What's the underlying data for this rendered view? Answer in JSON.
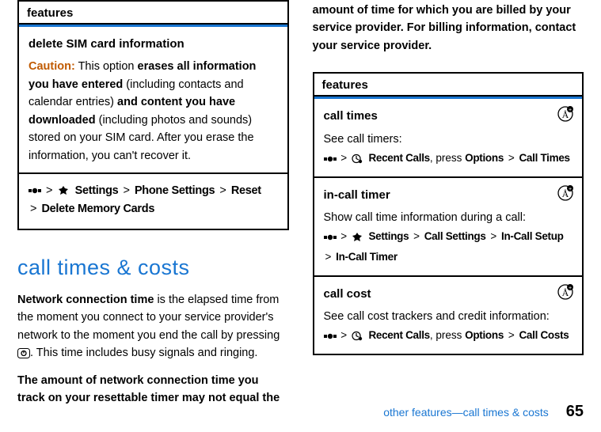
{
  "left": {
    "features_header": "features",
    "delete_sim_subhdr": "delete SIM card information",
    "caution_label": "Caution:",
    "caution_body_1": " This option ",
    "caution_body_2": "erases all information you have entered",
    "caution_body_3": " (including contacts and calendar entries) ",
    "caution_body_4": "and content you have downloaded",
    "caution_body_5": " (including photos and sounds) stored on your SIM card. After you erase the information, you can't recover it.",
    "path_settings": "Settings",
    "path_phone_settings": "Phone Settings",
    "path_reset": "Reset",
    "path_delete_mem": "Delete Memory Cards"
  },
  "section_title": "call times & costs",
  "body1a": "Network connection time",
  "body1b": " is the elapsed time from the moment you connect to your service provider's network to the moment you end the call by pressing ",
  "body1c": ". This time includes busy signals and ringing.",
  "body2": "The amount of network connection time you track on your resettable timer may not equal the ",
  "right_intro": "amount of time for which you are billed by your service provider. For billing information, contact your service provider.",
  "right": {
    "features_header": "features",
    "row1": {
      "title": "call times",
      "desc": "See call timers:",
      "recent": "Recent Calls",
      "press": ", press ",
      "options": "Options",
      "calltimes": "Call Times"
    },
    "row2": {
      "title": "in-call timer",
      "desc": "Show call time information during a call:",
      "settings": "Settings",
      "callsettings": "Call Settings",
      "incallsetup": "In-Call Setup",
      "incalltimer": "In-Call Timer"
    },
    "row3": {
      "title": "call cost",
      "desc": "See call cost trackers and credit information:",
      "recent": "Recent Calls",
      "press": ", press ",
      "options": "Options",
      "callcosts": "Call Costs"
    }
  },
  "footer": {
    "text": "other features—call times & costs",
    "page": "65"
  }
}
